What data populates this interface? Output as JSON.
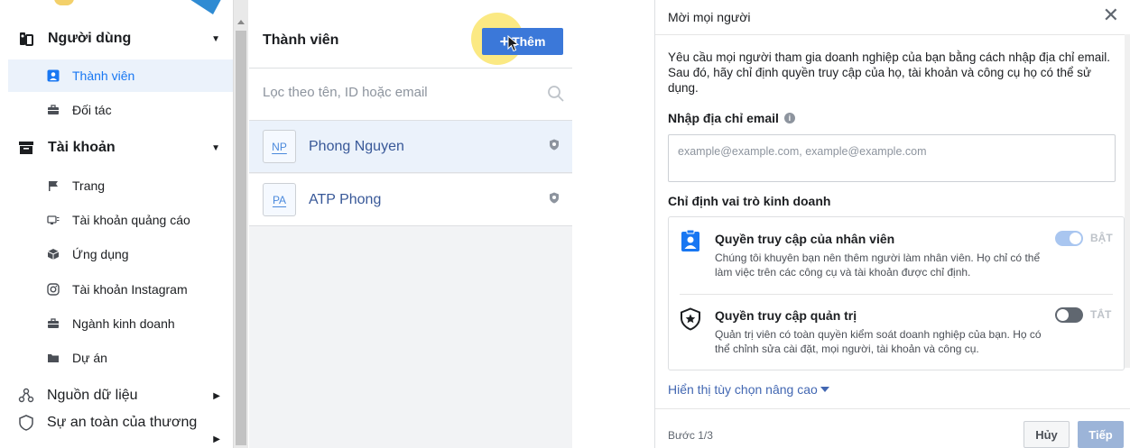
{
  "sidebar": {
    "users": {
      "label": "Người dùng",
      "icon": "users-icon",
      "items": [
        {
          "label": "Thành viên",
          "icon": "person-badge-icon",
          "active": true
        },
        {
          "label": "Đối tác",
          "icon": "briefcase-icon",
          "active": false
        }
      ]
    },
    "accounts": {
      "label": "Tài khoản",
      "icon": "archive-icon",
      "items": [
        {
          "label": "Trang",
          "icon": "flag-icon"
        },
        {
          "label": "Tài khoản quảng cáo",
          "icon": "ad-account-icon"
        },
        {
          "label": "Ứng dụng",
          "icon": "cube-icon"
        },
        {
          "label": "Tài khoản Instagram",
          "icon": "instagram-icon"
        },
        {
          "label": "Ngành kinh doanh",
          "icon": "briefcase-icon"
        },
        {
          "label": "Dự án",
          "icon": "folder-icon"
        }
      ]
    },
    "data_sources": {
      "label": "Nguồn dữ liệu",
      "icon": "data-nodes-icon"
    },
    "safety": {
      "label": "Sự an toàn của thương",
      "icon": "shield-icon"
    }
  },
  "members": {
    "title": "Thành viên",
    "add_label": "Thêm",
    "search_placeholder": "Lọc theo tên, ID hoặc email",
    "list": [
      {
        "initials": "NP",
        "name": "Phong Nguyen",
        "selected": true
      },
      {
        "initials": "PA",
        "name": "ATP Phong",
        "selected": false
      }
    ]
  },
  "dialog": {
    "title": "Mời mọi người",
    "description": "Yêu cầu mọi người tham gia doanh nghiệp của bạn bằng cách nhập địa chỉ email. Sau đó, hãy chỉ định quyền truy cập của họ, tài khoản và công cụ họ có thể sử dụng.",
    "email_label": "Nhập địa chỉ email",
    "email_placeholder": "example@example.com, example@example.com",
    "role_label": "Chỉ định vai trò kinh doanh",
    "roles": [
      {
        "title": "Quyền truy cập của nhân viên",
        "description": "Chúng tôi khuyên bạn nên thêm người làm nhân viên. Họ chỉ có thể làm việc trên các công cụ và tài khoản được chỉ định.",
        "state": "BẬT",
        "on": true
      },
      {
        "title": "Quyền truy cập quản trị",
        "description": "Quản trị viên có toàn quyền kiểm soát doanh nghiệp của bạn. Họ có thể chỉnh sửa cài đặt, mọi người, tài khoản và công cụ.",
        "state": "TẮT",
        "on": false
      }
    ],
    "advanced_label": "Hiển thị tùy chọn nâng cao",
    "step": "Bước 1/3",
    "cancel_label": "Hủy",
    "next_label": "Tiếp"
  },
  "colors": {
    "accent": "#1877f2",
    "link": "#385898",
    "add_button": "#3b78d9",
    "highlight": "#fae15a"
  }
}
